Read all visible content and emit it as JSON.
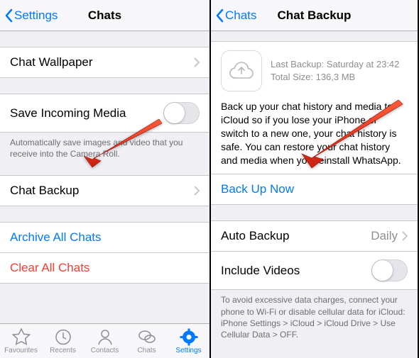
{
  "left": {
    "nav": {
      "back": "Settings",
      "title": "Chats"
    },
    "wallpaper": "Chat Wallpaper",
    "saveMedia": "Save Incoming Media",
    "saveMediaNote": "Automatically save images and video that you receive into the Camera Roll.",
    "chatBackup": "Chat Backup",
    "archive": "Archive All Chats",
    "clear": "Clear All Chats",
    "tabs": {
      "favourites": "Favourites",
      "recents": "Recents",
      "contacts": "Contacts",
      "chats": "Chats",
      "settings": "Settings"
    }
  },
  "right": {
    "nav": {
      "back": "Chats",
      "title": "Chat Backup"
    },
    "lastBackup": "Last Backup: Saturday at 23:42",
    "totalSize": "Total Size: 136,3 MB",
    "desc": "Back up your chat history and media to iCloud so if you lose your iPhone or switch to a new one, your chat history is safe. You can restore your chat history and media when you reinstall WhatsApp.",
    "backUpNow": "Back Up Now",
    "autoBackup": "Auto Backup",
    "autoBackupValue": "Daily",
    "includeVideos": "Include Videos",
    "note": "To avoid excessive data charges, connect your phone to Wi-Fi or disable cellular data for iCloud: iPhone Settings > iCloud > iCloud Drive > Use Cellular Data > OFF."
  }
}
